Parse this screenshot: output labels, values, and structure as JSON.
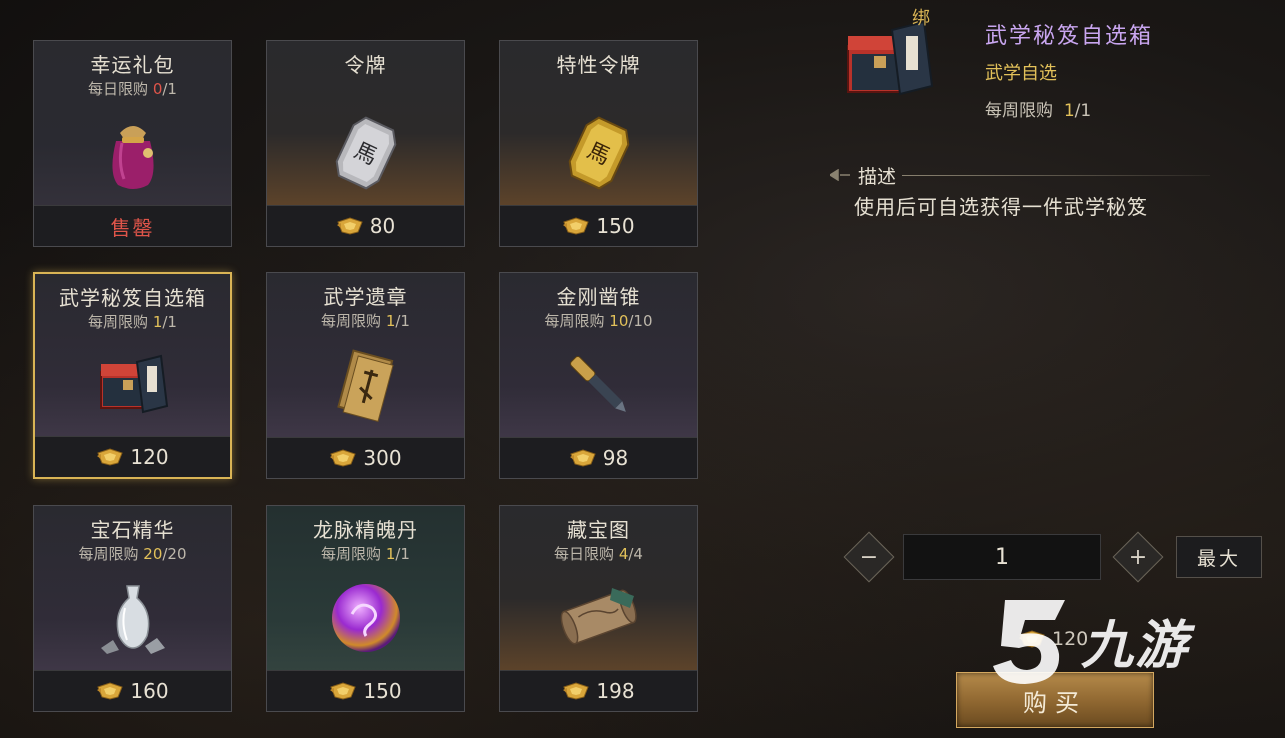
{
  "shop": {
    "items": [
      {
        "name": "幸运礼包",
        "limit_label": "每日限购",
        "limit_current": "0",
        "limit_max": "/1",
        "price": "",
        "status": "售罄",
        "icon": "lucky-bag-icon"
      },
      {
        "name": "令牌",
        "limit_label": "",
        "limit_current": "",
        "limit_max": "",
        "price": "80",
        "status": "",
        "icon": "silver-token-icon"
      },
      {
        "name": "特性令牌",
        "limit_label": "",
        "limit_current": "",
        "limit_max": "",
        "price": "150",
        "status": "",
        "icon": "gold-token-icon"
      },
      {
        "name": "武学秘笈自选箱",
        "limit_label": "每周限购",
        "limit_current": "1",
        "limit_max": "/1",
        "price": "120",
        "status": "",
        "icon": "martial-chest-icon"
      },
      {
        "name": "武学遗章",
        "limit_label": "每周限购",
        "limit_current": "1",
        "limit_max": "/1",
        "price": "300",
        "status": "",
        "icon": "scroll-pages-icon"
      },
      {
        "name": "金刚凿锥",
        "limit_label": "每周限购",
        "limit_current": "10",
        "limit_max": "/10",
        "price": "98",
        "status": "",
        "icon": "chisel-icon"
      },
      {
        "name": "宝石精华",
        "limit_label": "每周限购",
        "limit_current": "20",
        "limit_max": "/20",
        "price": "160",
        "status": "",
        "icon": "vase-icon"
      },
      {
        "name": "龙脉精魄丹",
        "limit_label": "每周限购",
        "limit_current": "1",
        "limit_max": "/1",
        "price": "150",
        "status": "",
        "icon": "dragon-orb-icon"
      },
      {
        "name": "藏宝图",
        "limit_label": "每日限购",
        "limit_current": "4",
        "limit_max": "/4",
        "price": "198",
        "status": "",
        "icon": "treasure-map-icon"
      }
    ]
  },
  "detail": {
    "bound_label": "绑",
    "title": "武学秘笈自选箱",
    "subtitle": "武学自选",
    "limit_label": "每周限购",
    "limit_current": "1",
    "limit_max": "/1",
    "desc_label": "描述",
    "desc_text": "使用后可自选获得一件武学秘笈",
    "quantity": "1",
    "max_label": "最大",
    "total_price": "120",
    "buy_label": "购买",
    "minus_label": "−",
    "plus_label": "+"
  },
  "watermark": {
    "text": "九游"
  },
  "colors": {
    "accent_gold": "#e2c15a",
    "sold_out_red": "#e0554a",
    "title_purple": "#c9a6f0",
    "selected_border": "#d9b455"
  }
}
